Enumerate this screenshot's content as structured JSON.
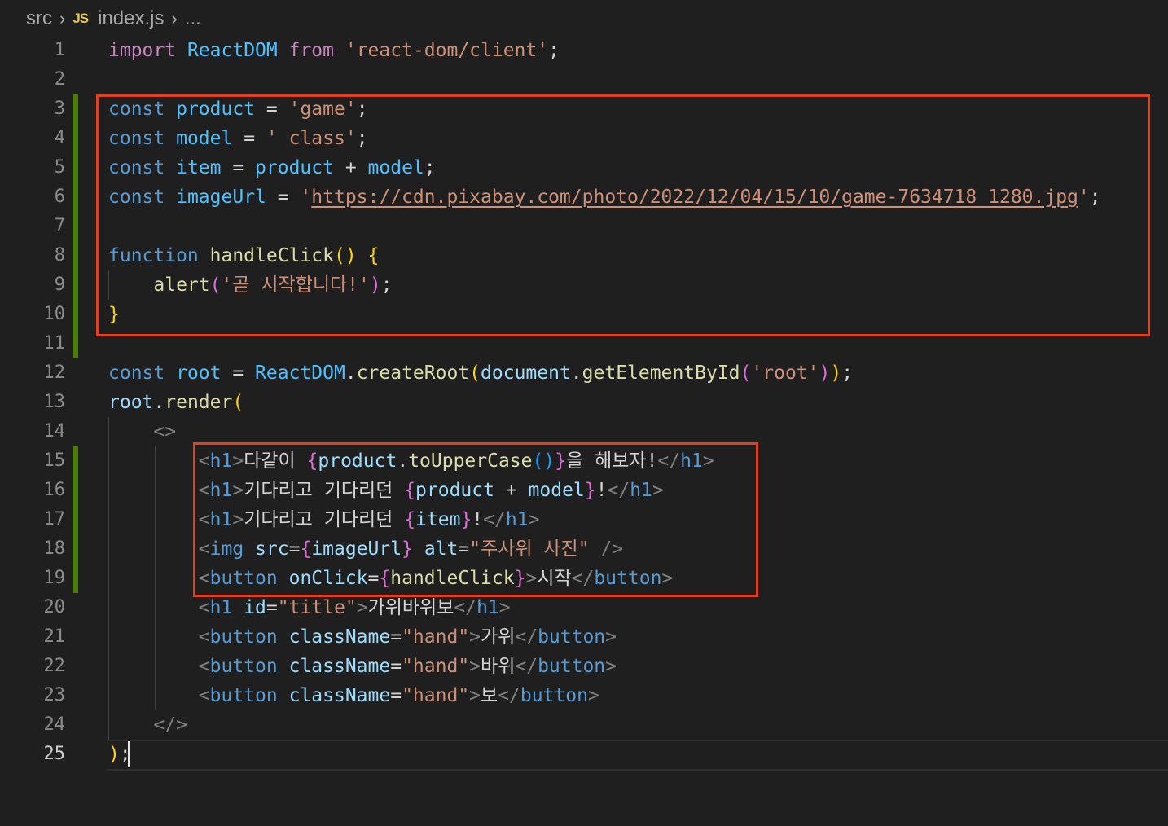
{
  "breadcrumb": {
    "folder": "src",
    "file_icon": "JS",
    "file": "index.js",
    "more": "..."
  },
  "editor": {
    "active_line": 25,
    "line_numbers": [
      "1",
      "2",
      "3",
      "4",
      "5",
      "6",
      "7",
      "8",
      "9",
      "10",
      "11",
      "12",
      "13",
      "14",
      "15",
      "16",
      "17",
      "18",
      "19",
      "20",
      "21",
      "22",
      "23",
      "24",
      "25"
    ],
    "colors": {
      "keyword": "#569cd6",
      "variable": "#4fc1ff",
      "function": "#dcdcaa",
      "string": "#ce9178",
      "highlight_border": "#e2401f",
      "modified_gutter": "#487e02"
    },
    "lines": [
      [
        [
          "kw2",
          "import"
        ],
        [
          "txt",
          " "
        ],
        [
          "var",
          "ReactDOM"
        ],
        [
          "txt",
          " "
        ],
        [
          "kw2",
          "from"
        ],
        [
          "txt",
          " "
        ],
        [
          "str",
          "'react-dom/client'"
        ],
        [
          "txt",
          ";"
        ]
      ],
      [],
      [
        [
          "kw",
          "const"
        ],
        [
          "txt",
          " "
        ],
        [
          "var",
          "product"
        ],
        [
          "txt",
          " = "
        ],
        [
          "str",
          "'game'"
        ],
        [
          "txt",
          ";"
        ]
      ],
      [
        [
          "kw",
          "const"
        ],
        [
          "txt",
          " "
        ],
        [
          "var",
          "model"
        ],
        [
          "txt",
          " = "
        ],
        [
          "str",
          "' class'"
        ],
        [
          "txt",
          ";"
        ]
      ],
      [
        [
          "kw",
          "const"
        ],
        [
          "txt",
          " "
        ],
        [
          "var",
          "item"
        ],
        [
          "txt",
          " = "
        ],
        [
          "var",
          "product"
        ],
        [
          "txt",
          " + "
        ],
        [
          "var",
          "model"
        ],
        [
          "txt",
          ";"
        ]
      ],
      [
        [
          "kw",
          "const"
        ],
        [
          "txt",
          " "
        ],
        [
          "var",
          "imageUrl"
        ],
        [
          "txt",
          " = "
        ],
        [
          "str",
          "'"
        ],
        [
          "url",
          "https://cdn.pixabay.com/photo/2022/12/04/15/10/game-7634718_1280.jpg"
        ],
        [
          "str",
          "'"
        ],
        [
          "txt",
          ";"
        ]
      ],
      [],
      [
        [
          "kw",
          "function"
        ],
        [
          "txt",
          " "
        ],
        [
          "fn",
          "handleClick"
        ],
        [
          "br1",
          "()"
        ],
        [
          "txt",
          " "
        ],
        [
          "br1",
          "{"
        ]
      ],
      [
        [
          "txt",
          "    "
        ],
        [
          "fn",
          "alert"
        ],
        [
          "br2",
          "("
        ],
        [
          "str",
          "'곧 시작합니다!'"
        ],
        [
          "br2",
          ")"
        ],
        [
          "txt",
          ";"
        ]
      ],
      [
        [
          "br1",
          "}"
        ]
      ],
      [],
      [
        [
          "kw",
          "const"
        ],
        [
          "txt",
          " "
        ],
        [
          "var",
          "root"
        ],
        [
          "txt",
          " = "
        ],
        [
          "var",
          "ReactDOM"
        ],
        [
          "txt",
          "."
        ],
        [
          "fn",
          "createRoot"
        ],
        [
          "br1",
          "("
        ],
        [
          "v2",
          "document"
        ],
        [
          "txt",
          "."
        ],
        [
          "fn",
          "getElementById"
        ],
        [
          "br2",
          "("
        ],
        [
          "str",
          "'root'"
        ],
        [
          "br2",
          ")"
        ],
        [
          "br1",
          ")"
        ],
        [
          "txt",
          ";"
        ]
      ],
      [
        [
          "v2",
          "root"
        ],
        [
          "txt",
          "."
        ],
        [
          "fn",
          "render"
        ],
        [
          "br1",
          "("
        ]
      ],
      [
        [
          "txt",
          "    "
        ],
        [
          "pun",
          "<>"
        ]
      ],
      [
        [
          "txt",
          "        "
        ],
        [
          "pun",
          "<"
        ],
        [
          "tag",
          "h1"
        ],
        [
          "pun",
          ">"
        ],
        [
          "txt",
          "다같이 "
        ],
        [
          "br2",
          "{"
        ],
        [
          "v2",
          "product"
        ],
        [
          "txt",
          "."
        ],
        [
          "fn",
          "toUpperCase"
        ],
        [
          "br3",
          "()"
        ],
        [
          "br2",
          "}"
        ],
        [
          "txt",
          "을 해보자!"
        ],
        [
          "pun",
          "</"
        ],
        [
          "tag",
          "h1"
        ],
        [
          "pun",
          ">"
        ]
      ],
      [
        [
          "txt",
          "        "
        ],
        [
          "pun",
          "<"
        ],
        [
          "tag",
          "h1"
        ],
        [
          "pun",
          ">"
        ],
        [
          "txt",
          "기다리고 기다리던 "
        ],
        [
          "br2",
          "{"
        ],
        [
          "v2",
          "product"
        ],
        [
          "txt",
          " + "
        ],
        [
          "v2",
          "model"
        ],
        [
          "br2",
          "}"
        ],
        [
          "txt",
          "!"
        ],
        [
          "pun",
          "</"
        ],
        [
          "tag",
          "h1"
        ],
        [
          "pun",
          ">"
        ]
      ],
      [
        [
          "txt",
          "        "
        ],
        [
          "pun",
          "<"
        ],
        [
          "tag",
          "h1"
        ],
        [
          "pun",
          ">"
        ],
        [
          "txt",
          "기다리고 기다리던 "
        ],
        [
          "br2",
          "{"
        ],
        [
          "v2",
          "item"
        ],
        [
          "br2",
          "}"
        ],
        [
          "txt",
          "!"
        ],
        [
          "pun",
          "</"
        ],
        [
          "tag",
          "h1"
        ],
        [
          "pun",
          ">"
        ]
      ],
      [
        [
          "txt",
          "        "
        ],
        [
          "pun",
          "<"
        ],
        [
          "tag",
          "img"
        ],
        [
          "txt",
          " "
        ],
        [
          "attr",
          "src"
        ],
        [
          "txt",
          "="
        ],
        [
          "br2",
          "{"
        ],
        [
          "v2",
          "imageUrl"
        ],
        [
          "br2",
          "}"
        ],
        [
          "txt",
          " "
        ],
        [
          "attr",
          "alt"
        ],
        [
          "txt",
          "="
        ],
        [
          "str",
          "\"주사위 사진\""
        ],
        [
          "txt",
          " "
        ],
        [
          "pun",
          "/>"
        ]
      ],
      [
        [
          "txt",
          "        "
        ],
        [
          "pun",
          "<"
        ],
        [
          "tag",
          "button"
        ],
        [
          "txt",
          " "
        ],
        [
          "attr",
          "onClick"
        ],
        [
          "txt",
          "="
        ],
        [
          "br2",
          "{"
        ],
        [
          "fn",
          "handleClick"
        ],
        [
          "br2",
          "}"
        ],
        [
          "pun",
          ">"
        ],
        [
          "txt",
          "시작"
        ],
        [
          "pun",
          "</"
        ],
        [
          "tag",
          "button"
        ],
        [
          "pun",
          ">"
        ]
      ],
      [
        [
          "txt",
          "        "
        ],
        [
          "pun",
          "<"
        ],
        [
          "tag",
          "h1"
        ],
        [
          "txt",
          " "
        ],
        [
          "attr",
          "id"
        ],
        [
          "txt",
          "="
        ],
        [
          "str",
          "\"title\""
        ],
        [
          "pun",
          ">"
        ],
        [
          "txt",
          "가위바위보"
        ],
        [
          "pun",
          "</"
        ],
        [
          "tag",
          "h1"
        ],
        [
          "pun",
          ">"
        ]
      ],
      [
        [
          "txt",
          "        "
        ],
        [
          "pun",
          "<"
        ],
        [
          "tag",
          "button"
        ],
        [
          "txt",
          " "
        ],
        [
          "attr",
          "className"
        ],
        [
          "txt",
          "="
        ],
        [
          "str",
          "\"hand\""
        ],
        [
          "pun",
          ">"
        ],
        [
          "txt",
          "가위"
        ],
        [
          "pun",
          "</"
        ],
        [
          "tag",
          "button"
        ],
        [
          "pun",
          ">"
        ]
      ],
      [
        [
          "txt",
          "        "
        ],
        [
          "pun",
          "<"
        ],
        [
          "tag",
          "button"
        ],
        [
          "txt",
          " "
        ],
        [
          "attr",
          "className"
        ],
        [
          "txt",
          "="
        ],
        [
          "str",
          "\"hand\""
        ],
        [
          "pun",
          ">"
        ],
        [
          "txt",
          "바위"
        ],
        [
          "pun",
          "</"
        ],
        [
          "tag",
          "button"
        ],
        [
          "pun",
          ">"
        ]
      ],
      [
        [
          "txt",
          "        "
        ],
        [
          "pun",
          "<"
        ],
        [
          "tag",
          "button"
        ],
        [
          "txt",
          " "
        ],
        [
          "attr",
          "className"
        ],
        [
          "txt",
          "="
        ],
        [
          "str",
          "\"hand\""
        ],
        [
          "pun",
          ">"
        ],
        [
          "txt",
          "보"
        ],
        [
          "pun",
          "</"
        ],
        [
          "tag",
          "button"
        ],
        [
          "pun",
          ">"
        ]
      ],
      [
        [
          "txt",
          "    "
        ],
        [
          "pun",
          "</>"
        ]
      ],
      [
        [
          "br1",
          ")"
        ],
        [
          "txt",
          ";"
        ]
      ]
    ]
  }
}
